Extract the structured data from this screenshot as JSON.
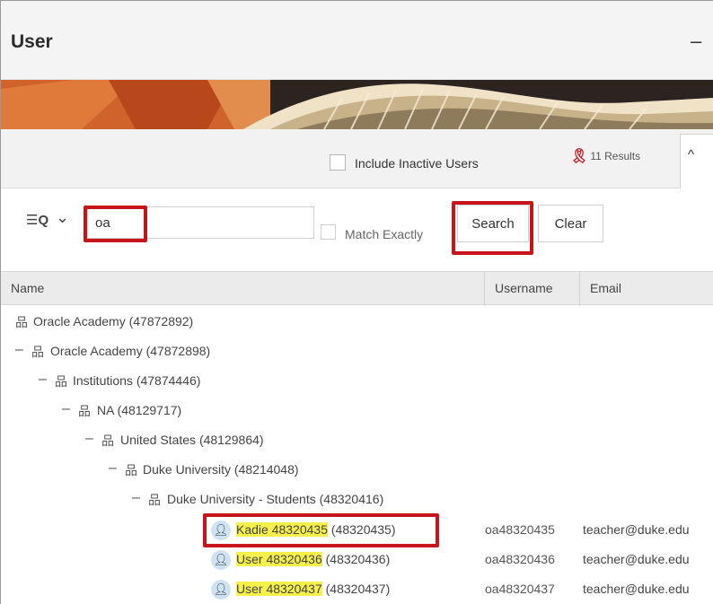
{
  "window": {
    "title": "User",
    "minimize_symbol": "–"
  },
  "toolbar": {
    "include_inactive_label": "Include Inactive Users",
    "results_label": "11 Results",
    "results_icon": "ribbon-icon",
    "collapse_tab_label": "^"
  },
  "search": {
    "filter_icon": "filter-search-icon",
    "filter_glyph": "☰Q",
    "caret": "⌄",
    "value": "oa",
    "match_exactly_label": "Match Exactly",
    "search_button": "Search",
    "clear_button": "Clear"
  },
  "table": {
    "columns": {
      "name": "Name",
      "username": "Username",
      "email": "Email"
    },
    "tree": [
      {
        "label": "Oracle Academy (47872892)",
        "toggle": ""
      },
      {
        "label": "Oracle Academy (47872898)",
        "toggle": "–"
      },
      {
        "label": "Institutions (47874446)",
        "toggle": "–"
      },
      {
        "label": "NA (48129717)",
        "toggle": "–"
      },
      {
        "label": "United States (48129864)",
        "toggle": "–"
      },
      {
        "label": "Duke University (48214048)",
        "toggle": "–"
      },
      {
        "label": "Duke University - Students (48320416)",
        "toggle": "–"
      }
    ],
    "users": [
      {
        "name": "Kadie 48320435",
        "id": "(48320435)",
        "username": "oa48320435",
        "email": "teacher@duke.edu"
      },
      {
        "name": "User 48320436",
        "id": "(48320436)",
        "username": "oa48320436",
        "email": "teacher@duke.edu"
      },
      {
        "name": "User 48320437",
        "id": "(48320437)",
        "username": "oa48320437",
        "email": "teacher@duke.edu"
      }
    ]
  },
  "colors": {
    "highlight_box": "#c8151b",
    "match_highlight": "#f6f14a",
    "user_icon_bg": "#cde2f2"
  }
}
